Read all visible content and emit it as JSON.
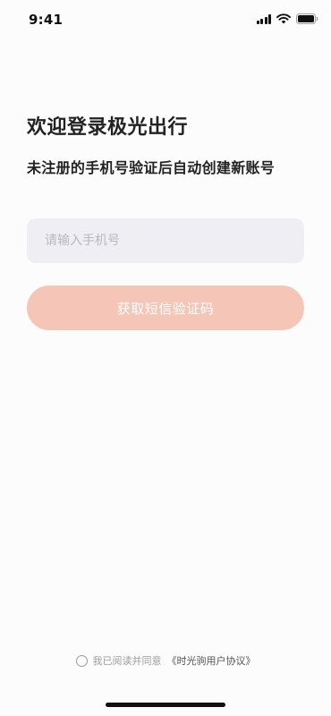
{
  "status_bar": {
    "time": "9:41",
    "icons": [
      "cellular-signal-icon",
      "wifi-icon",
      "battery-icon"
    ]
  },
  "login": {
    "title": "欢迎登录极光出行",
    "subtitle": "未注册的手机号验证后自动创建新账号",
    "phone_input": {
      "placeholder": "请输入手机号",
      "value": ""
    },
    "get_code_button": "获取短信验证码"
  },
  "agreement": {
    "checked": false,
    "text": "我已阅读并同意",
    "link": "《时光驹用户协议》"
  },
  "colors": {
    "background": "#fdfcfc",
    "input_background": "#efeef3",
    "button_disabled": "#f5c6b7",
    "text_primary": "#222222",
    "text_muted": "#9d9d9d"
  }
}
